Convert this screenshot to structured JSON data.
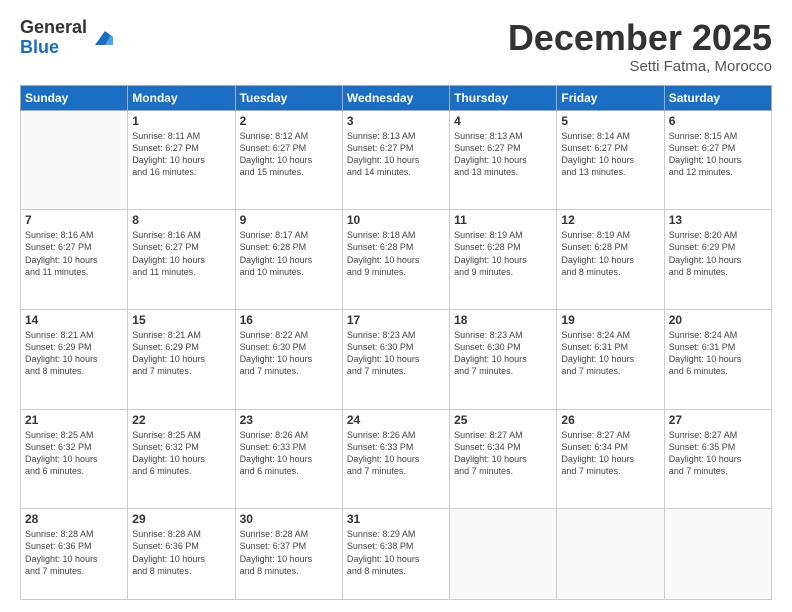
{
  "logo": {
    "general": "General",
    "blue": "Blue"
  },
  "header": {
    "month": "December 2025",
    "location": "Setti Fatma, Morocco"
  },
  "days_of_week": [
    "Sunday",
    "Monday",
    "Tuesday",
    "Wednesday",
    "Thursday",
    "Friday",
    "Saturday"
  ],
  "weeks": [
    [
      {
        "day": "",
        "info": ""
      },
      {
        "day": "1",
        "info": "Sunrise: 8:11 AM\nSunset: 6:27 PM\nDaylight: 10 hours\nand 16 minutes."
      },
      {
        "day": "2",
        "info": "Sunrise: 8:12 AM\nSunset: 6:27 PM\nDaylight: 10 hours\nand 15 minutes."
      },
      {
        "day": "3",
        "info": "Sunrise: 8:13 AM\nSunset: 6:27 PM\nDaylight: 10 hours\nand 14 minutes."
      },
      {
        "day": "4",
        "info": "Sunrise: 8:13 AM\nSunset: 6:27 PM\nDaylight: 10 hours\nand 13 minutes."
      },
      {
        "day": "5",
        "info": "Sunrise: 8:14 AM\nSunset: 6:27 PM\nDaylight: 10 hours\nand 13 minutes."
      },
      {
        "day": "6",
        "info": "Sunrise: 8:15 AM\nSunset: 6:27 PM\nDaylight: 10 hours\nand 12 minutes."
      }
    ],
    [
      {
        "day": "7",
        "info": "Sunrise: 8:16 AM\nSunset: 6:27 PM\nDaylight: 10 hours\nand 11 minutes."
      },
      {
        "day": "8",
        "info": "Sunrise: 8:16 AM\nSunset: 6:27 PM\nDaylight: 10 hours\nand 11 minutes."
      },
      {
        "day": "9",
        "info": "Sunrise: 8:17 AM\nSunset: 6:28 PM\nDaylight: 10 hours\nand 10 minutes."
      },
      {
        "day": "10",
        "info": "Sunrise: 8:18 AM\nSunset: 6:28 PM\nDaylight: 10 hours\nand 9 minutes."
      },
      {
        "day": "11",
        "info": "Sunrise: 8:19 AM\nSunset: 6:28 PM\nDaylight: 10 hours\nand 9 minutes."
      },
      {
        "day": "12",
        "info": "Sunrise: 8:19 AM\nSunset: 6:28 PM\nDaylight: 10 hours\nand 8 minutes."
      },
      {
        "day": "13",
        "info": "Sunrise: 8:20 AM\nSunset: 6:29 PM\nDaylight: 10 hours\nand 8 minutes."
      }
    ],
    [
      {
        "day": "14",
        "info": "Sunrise: 8:21 AM\nSunset: 6:29 PM\nDaylight: 10 hours\nand 8 minutes."
      },
      {
        "day": "15",
        "info": "Sunrise: 8:21 AM\nSunset: 6:29 PM\nDaylight: 10 hours\nand 7 minutes."
      },
      {
        "day": "16",
        "info": "Sunrise: 8:22 AM\nSunset: 6:30 PM\nDaylight: 10 hours\nand 7 minutes."
      },
      {
        "day": "17",
        "info": "Sunrise: 8:23 AM\nSunset: 6:30 PM\nDaylight: 10 hours\nand 7 minutes."
      },
      {
        "day": "18",
        "info": "Sunrise: 8:23 AM\nSunset: 6:30 PM\nDaylight: 10 hours\nand 7 minutes."
      },
      {
        "day": "19",
        "info": "Sunrise: 8:24 AM\nSunset: 6:31 PM\nDaylight: 10 hours\nand 7 minutes."
      },
      {
        "day": "20",
        "info": "Sunrise: 8:24 AM\nSunset: 6:31 PM\nDaylight: 10 hours\nand 6 minutes."
      }
    ],
    [
      {
        "day": "21",
        "info": "Sunrise: 8:25 AM\nSunset: 6:32 PM\nDaylight: 10 hours\nand 6 minutes."
      },
      {
        "day": "22",
        "info": "Sunrise: 8:25 AM\nSunset: 6:32 PM\nDaylight: 10 hours\nand 6 minutes."
      },
      {
        "day": "23",
        "info": "Sunrise: 8:26 AM\nSunset: 6:33 PM\nDaylight: 10 hours\nand 6 minutes."
      },
      {
        "day": "24",
        "info": "Sunrise: 8:26 AM\nSunset: 6:33 PM\nDaylight: 10 hours\nand 7 minutes."
      },
      {
        "day": "25",
        "info": "Sunrise: 8:27 AM\nSunset: 6:34 PM\nDaylight: 10 hours\nand 7 minutes."
      },
      {
        "day": "26",
        "info": "Sunrise: 8:27 AM\nSunset: 6:34 PM\nDaylight: 10 hours\nand 7 minutes."
      },
      {
        "day": "27",
        "info": "Sunrise: 8:27 AM\nSunset: 6:35 PM\nDaylight: 10 hours\nand 7 minutes."
      }
    ],
    [
      {
        "day": "28",
        "info": "Sunrise: 8:28 AM\nSunset: 6:36 PM\nDaylight: 10 hours\nand 7 minutes."
      },
      {
        "day": "29",
        "info": "Sunrise: 8:28 AM\nSunset: 6:36 PM\nDaylight: 10 hours\nand 8 minutes."
      },
      {
        "day": "30",
        "info": "Sunrise: 8:28 AM\nSunset: 6:37 PM\nDaylight: 10 hours\nand 8 minutes."
      },
      {
        "day": "31",
        "info": "Sunrise: 8:29 AM\nSunset: 6:38 PM\nDaylight: 10 hours\nand 8 minutes."
      },
      {
        "day": "",
        "info": ""
      },
      {
        "day": "",
        "info": ""
      },
      {
        "day": "",
        "info": ""
      }
    ]
  ]
}
